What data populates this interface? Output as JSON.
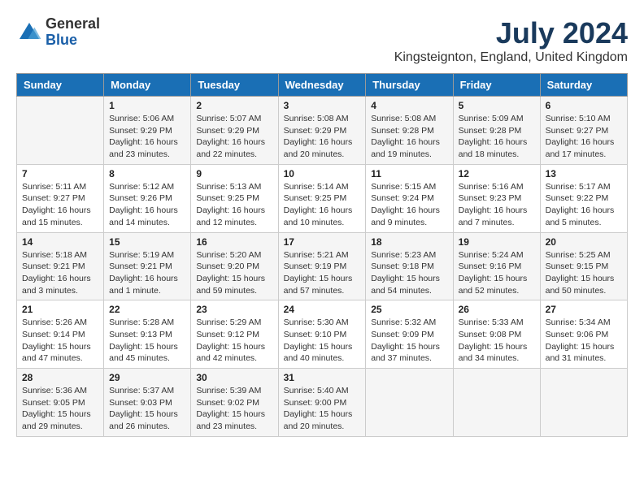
{
  "header": {
    "logo_line1": "General",
    "logo_line2": "Blue",
    "month_year": "July 2024",
    "location": "Kingsteignton, England, United Kingdom"
  },
  "days_of_week": [
    "Sunday",
    "Monday",
    "Tuesday",
    "Wednesday",
    "Thursday",
    "Friday",
    "Saturday"
  ],
  "weeks": [
    [
      {
        "day": "",
        "info": ""
      },
      {
        "day": "1",
        "info": "Sunrise: 5:06 AM\nSunset: 9:29 PM\nDaylight: 16 hours\nand 23 minutes."
      },
      {
        "day": "2",
        "info": "Sunrise: 5:07 AM\nSunset: 9:29 PM\nDaylight: 16 hours\nand 22 minutes."
      },
      {
        "day": "3",
        "info": "Sunrise: 5:08 AM\nSunset: 9:29 PM\nDaylight: 16 hours\nand 20 minutes."
      },
      {
        "day": "4",
        "info": "Sunrise: 5:08 AM\nSunset: 9:28 PM\nDaylight: 16 hours\nand 19 minutes."
      },
      {
        "day": "5",
        "info": "Sunrise: 5:09 AM\nSunset: 9:28 PM\nDaylight: 16 hours\nand 18 minutes."
      },
      {
        "day": "6",
        "info": "Sunrise: 5:10 AM\nSunset: 9:27 PM\nDaylight: 16 hours\nand 17 minutes."
      }
    ],
    [
      {
        "day": "7",
        "info": "Sunrise: 5:11 AM\nSunset: 9:27 PM\nDaylight: 16 hours\nand 15 minutes."
      },
      {
        "day": "8",
        "info": "Sunrise: 5:12 AM\nSunset: 9:26 PM\nDaylight: 16 hours\nand 14 minutes."
      },
      {
        "day": "9",
        "info": "Sunrise: 5:13 AM\nSunset: 9:25 PM\nDaylight: 16 hours\nand 12 minutes."
      },
      {
        "day": "10",
        "info": "Sunrise: 5:14 AM\nSunset: 9:25 PM\nDaylight: 16 hours\nand 10 minutes."
      },
      {
        "day": "11",
        "info": "Sunrise: 5:15 AM\nSunset: 9:24 PM\nDaylight: 16 hours\nand 9 minutes."
      },
      {
        "day": "12",
        "info": "Sunrise: 5:16 AM\nSunset: 9:23 PM\nDaylight: 16 hours\nand 7 minutes."
      },
      {
        "day": "13",
        "info": "Sunrise: 5:17 AM\nSunset: 9:22 PM\nDaylight: 16 hours\nand 5 minutes."
      }
    ],
    [
      {
        "day": "14",
        "info": "Sunrise: 5:18 AM\nSunset: 9:21 PM\nDaylight: 16 hours\nand 3 minutes."
      },
      {
        "day": "15",
        "info": "Sunrise: 5:19 AM\nSunset: 9:21 PM\nDaylight: 16 hours\nand 1 minute."
      },
      {
        "day": "16",
        "info": "Sunrise: 5:20 AM\nSunset: 9:20 PM\nDaylight: 15 hours\nand 59 minutes."
      },
      {
        "day": "17",
        "info": "Sunrise: 5:21 AM\nSunset: 9:19 PM\nDaylight: 15 hours\nand 57 minutes."
      },
      {
        "day": "18",
        "info": "Sunrise: 5:23 AM\nSunset: 9:18 PM\nDaylight: 15 hours\nand 54 minutes."
      },
      {
        "day": "19",
        "info": "Sunrise: 5:24 AM\nSunset: 9:16 PM\nDaylight: 15 hours\nand 52 minutes."
      },
      {
        "day": "20",
        "info": "Sunrise: 5:25 AM\nSunset: 9:15 PM\nDaylight: 15 hours\nand 50 minutes."
      }
    ],
    [
      {
        "day": "21",
        "info": "Sunrise: 5:26 AM\nSunset: 9:14 PM\nDaylight: 15 hours\nand 47 minutes."
      },
      {
        "day": "22",
        "info": "Sunrise: 5:28 AM\nSunset: 9:13 PM\nDaylight: 15 hours\nand 45 minutes."
      },
      {
        "day": "23",
        "info": "Sunrise: 5:29 AM\nSunset: 9:12 PM\nDaylight: 15 hours\nand 42 minutes."
      },
      {
        "day": "24",
        "info": "Sunrise: 5:30 AM\nSunset: 9:10 PM\nDaylight: 15 hours\nand 40 minutes."
      },
      {
        "day": "25",
        "info": "Sunrise: 5:32 AM\nSunset: 9:09 PM\nDaylight: 15 hours\nand 37 minutes."
      },
      {
        "day": "26",
        "info": "Sunrise: 5:33 AM\nSunset: 9:08 PM\nDaylight: 15 hours\nand 34 minutes."
      },
      {
        "day": "27",
        "info": "Sunrise: 5:34 AM\nSunset: 9:06 PM\nDaylight: 15 hours\nand 31 minutes."
      }
    ],
    [
      {
        "day": "28",
        "info": "Sunrise: 5:36 AM\nSunset: 9:05 PM\nDaylight: 15 hours\nand 29 minutes."
      },
      {
        "day": "29",
        "info": "Sunrise: 5:37 AM\nSunset: 9:03 PM\nDaylight: 15 hours\nand 26 minutes."
      },
      {
        "day": "30",
        "info": "Sunrise: 5:39 AM\nSunset: 9:02 PM\nDaylight: 15 hours\nand 23 minutes."
      },
      {
        "day": "31",
        "info": "Sunrise: 5:40 AM\nSunset: 9:00 PM\nDaylight: 15 hours\nand 20 minutes."
      },
      {
        "day": "",
        "info": ""
      },
      {
        "day": "",
        "info": ""
      },
      {
        "day": "",
        "info": ""
      }
    ]
  ]
}
